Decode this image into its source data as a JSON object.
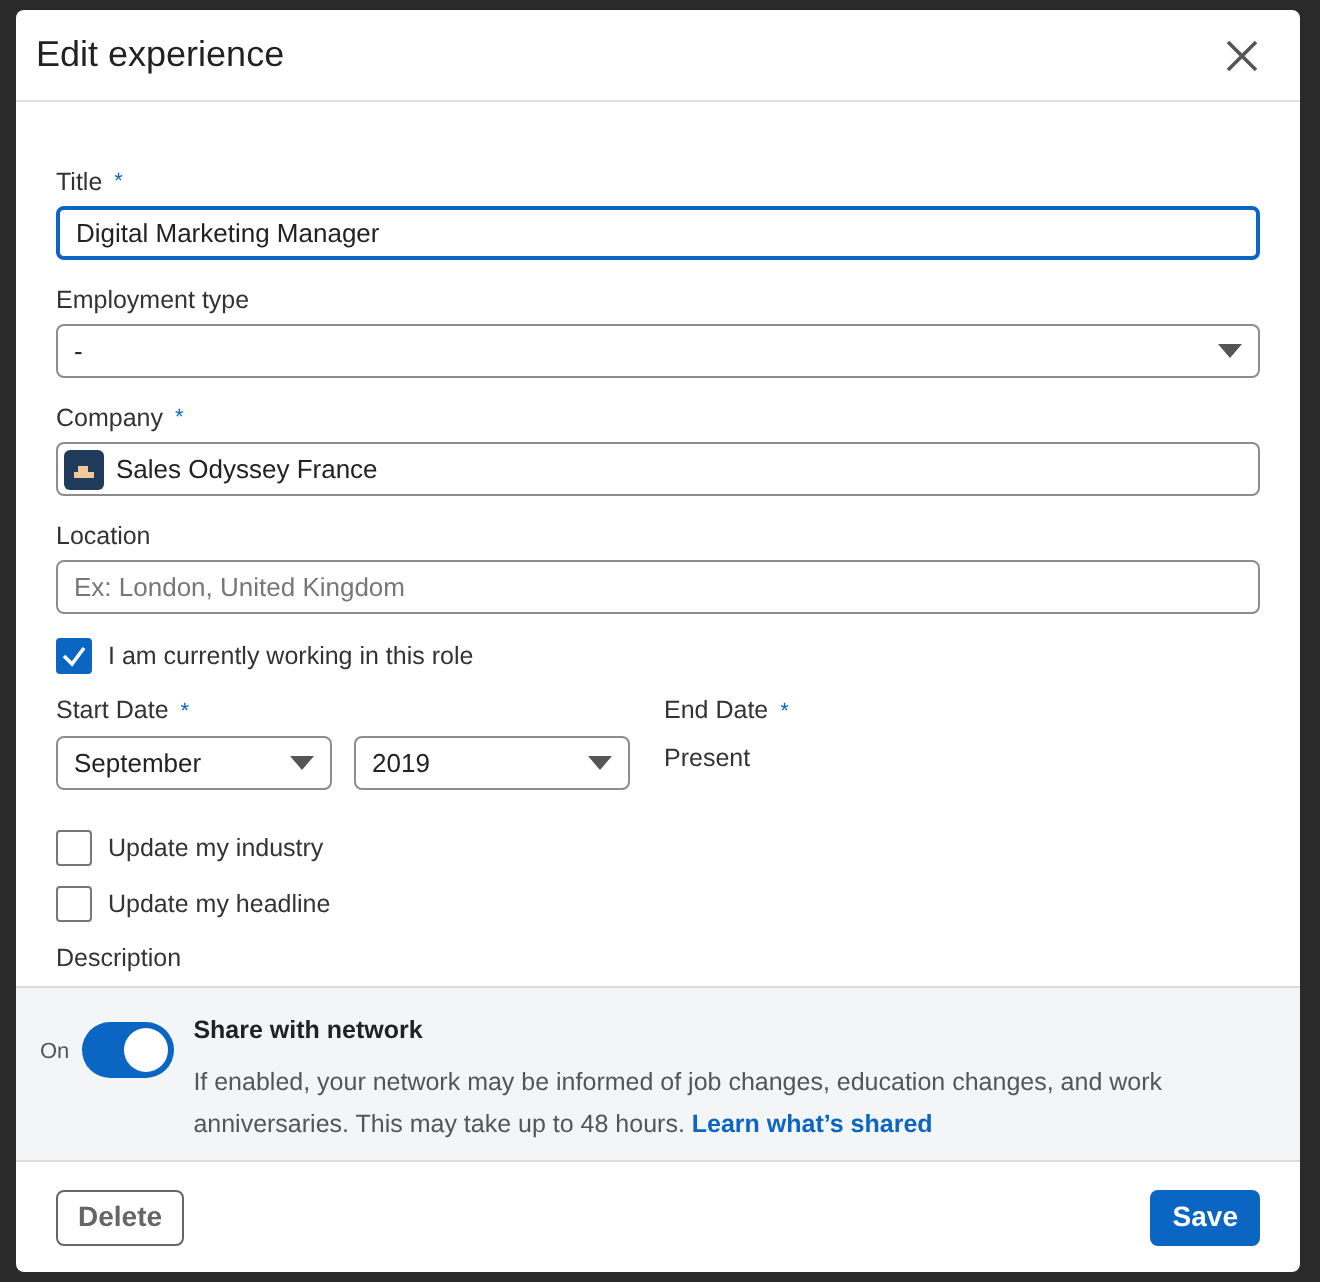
{
  "dialog": {
    "title": "Edit experience"
  },
  "fields": [
    {
      "kind": "text",
      "label": "Title",
      "required_mark": "*",
      "value": "Digital Marketing Manager",
      "focused": true
    },
    {
      "kind": "select",
      "label": "Employment type",
      "value": "-",
      "focused": false
    },
    {
      "kind": "company",
      "label": "Company",
      "required_mark": "*",
      "value": "Sales Odyssey France",
      "focused": false
    },
    {
      "kind": "text",
      "label": "Location",
      "placeholder": "Ex: London, United Kingdom",
      "focused": false
    }
  ],
  "current_role": {
    "label": "I am currently working in this role",
    "checked": true
  },
  "start_date": {
    "label": "Start Date",
    "required_mark": "*",
    "month": "September",
    "year": "2019"
  },
  "end_date": {
    "label": "End Date",
    "required_mark": "*",
    "value": "Present"
  },
  "options": [
    {
      "label": "Update my industry",
      "checked": false
    },
    {
      "label": "Update my headline",
      "checked": false
    }
  ],
  "description_label": "Description",
  "share": {
    "toggle_label": "On",
    "on": true,
    "title": "Share with network",
    "text": "If enabled, your network may be informed of job changes, education changes, and work anniversaries. This may take up to 48 hours.",
    "link": "Learn what’s shared"
  },
  "buttons": {
    "delete": "Delete",
    "save": "Save"
  }
}
